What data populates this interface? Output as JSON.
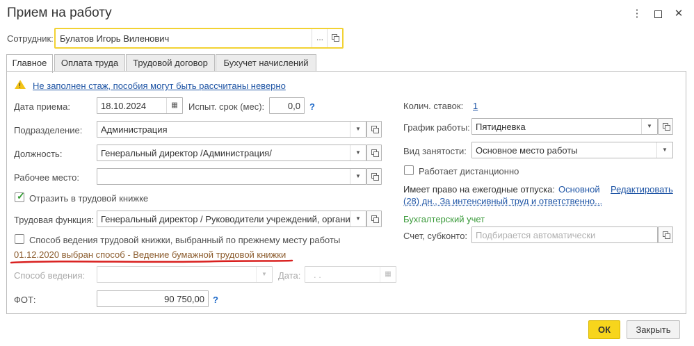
{
  "window": {
    "title": "Прием на работу",
    "menu_icon": "⋮",
    "maximize_icon": "□",
    "close_icon": "✕"
  },
  "employee": {
    "label": "Сотрудник:",
    "value": "Булатов Игорь Виленович",
    "dots": "..."
  },
  "tabs": [
    {
      "label": "Главное"
    },
    {
      "label": "Оплата труда"
    },
    {
      "label": "Трудовой договор"
    },
    {
      "label": "Бухучет начислений"
    }
  ],
  "warning": {
    "text": "Не заполнен стаж, пособия могут быть рассчитаны неверно"
  },
  "left": {
    "hire_date": {
      "label": "Дата приема:",
      "value": "18.10.2024"
    },
    "probation": {
      "label": "Испыт. срок (мес):",
      "value": "0,0",
      "help": "?"
    },
    "department": {
      "label": "Подразделение:",
      "value": "Администрация"
    },
    "position": {
      "label": "Должность:",
      "value": "Генеральный директор /Администрация/"
    },
    "workplace": {
      "label": "Рабочее место:",
      "value": ""
    },
    "workbook_reflect": {
      "label": "Отразить в трудовой книжке",
      "checked": true
    },
    "labor_function": {
      "label": "Трудовая функция:",
      "value": "Генеральный директор / Руководители учреждений, органи:"
    },
    "workbook_method_checkbox": {
      "label": "Способ ведения трудовой книжки, выбранный по прежнему месту работы",
      "checked": false
    },
    "workbook_note": "01.12.2020 выбран способ - Ведение бумажной трудовой книжки",
    "keeping_method": {
      "label": "Способ ведения:",
      "value": ""
    },
    "date": {
      "label": "Дата:",
      "value": ".   ."
    },
    "fot": {
      "label": "ФОТ:",
      "value": "90 750,00",
      "help": "?"
    }
  },
  "right": {
    "rates": {
      "label": "Колич. ставок:",
      "value": "1"
    },
    "schedule": {
      "label": "График работы:",
      "value": "Пятидневка"
    },
    "employment_type": {
      "label": "Вид занятости:",
      "value": "Основное место работы"
    },
    "remote": {
      "label": "Работает дистанционно",
      "checked": false
    },
    "vacation_label": "Имеет право на ежегодные отпуска:",
    "vacation_value_1": "Основной",
    "vacation_value_2": "(28) дн., За интенсивный труд и ответственно...",
    "edit_link": "Редактировать",
    "accounting_header": "Бухгалтерский учет",
    "account": {
      "label": "Счет, субконто:",
      "placeholder": "Подбирается автоматически"
    }
  },
  "buttons": {
    "ok": "ОК",
    "close": "Закрыть"
  },
  "colors": {
    "accent_yellow": "#f5d90a",
    "link": "#1f55a5",
    "underline_red": "#d9201f",
    "note_brown": "#8a5a2b",
    "green": "#3a9a3a"
  }
}
